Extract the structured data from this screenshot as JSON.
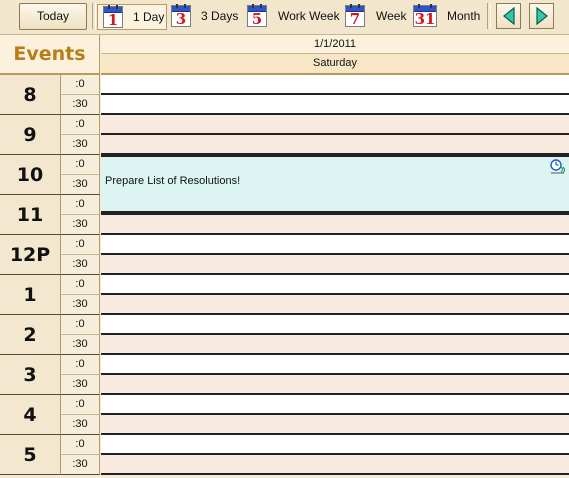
{
  "toolbar": {
    "today_label": "Today",
    "views": [
      {
        "label": "1 Day",
        "icon_number": "1",
        "icon": "day-calendar-icon"
      },
      {
        "label": "3 Days",
        "icon_number": "3",
        "icon": "three-days-calendar-icon"
      },
      {
        "label": "Work Week",
        "icon_number": "5",
        "icon": "work-week-calendar-icon"
      },
      {
        "label": "Week",
        "icon_number": "7",
        "icon": "week-calendar-icon"
      },
      {
        "label": "Month",
        "icon_number": "31",
        "icon": "month-calendar-icon"
      }
    ],
    "active_view": "1 Day",
    "nav": {
      "prev_icon": "triangle-left-icon",
      "next_icon": "triangle-right-icon"
    }
  },
  "sidebar": {
    "title": "Events",
    "hours": [
      {
        "label": "8",
        "half_a": ":0",
        "half_b": ":30"
      },
      {
        "label": "9",
        "half_a": ":0",
        "half_b": ":30"
      },
      {
        "label": "10",
        "half_a": ":0",
        "half_b": ":30"
      },
      {
        "label": "11",
        "half_a": ":0",
        "half_b": ":30"
      },
      {
        "label": "12P",
        "half_a": ":0",
        "half_b": ":30"
      },
      {
        "label": "1",
        "half_a": ":0",
        "half_b": ":30"
      },
      {
        "label": "2",
        "half_a": ":0",
        "half_b": ":30"
      },
      {
        "label": "3",
        "half_a": ":0",
        "half_b": ":30"
      },
      {
        "label": "4",
        "half_a": ":0",
        "half_b": ":30"
      },
      {
        "label": "5",
        "half_a": ":0",
        "half_b": ":30"
      }
    ]
  },
  "day": {
    "date": "1/1/2011",
    "weekday": "Saturday"
  },
  "appointment": {
    "text": "Prepare List of Resolutions!",
    "icon": "recurring-clock-icon",
    "start": "10:00",
    "end": "11:00"
  },
  "colors": {
    "accent_gold": "#b77d18",
    "appointment_bg": "#dcf5f3",
    "work_slot": "#ffffff",
    "tint_slot": "#f9eadf"
  }
}
